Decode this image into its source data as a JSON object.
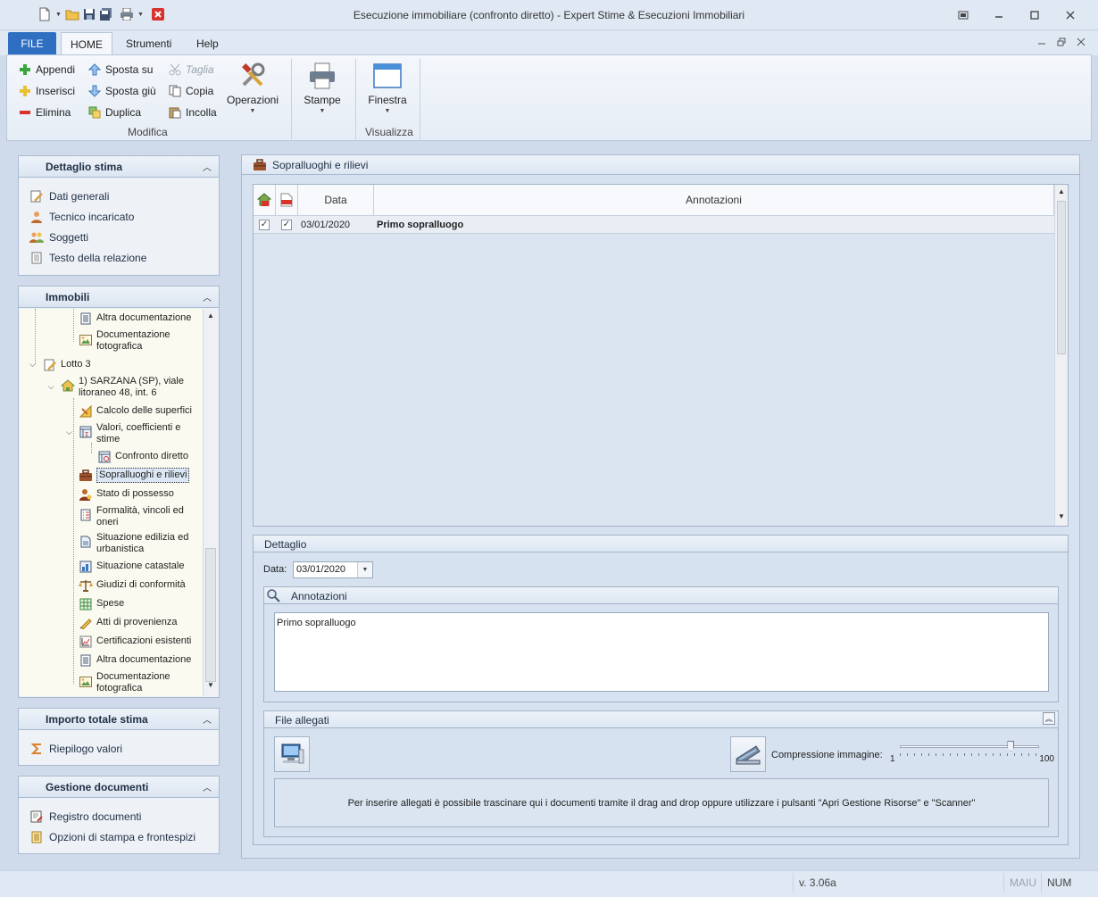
{
  "window": {
    "title": "Esecuzione immobiliare (confronto diretto) - Expert Stime & Esecuzioni Immobiliari"
  },
  "tabs": {
    "file": "FILE",
    "home": "HOME",
    "strumenti": "Strumenti",
    "help": "Help"
  },
  "ribbon": {
    "appendi": "Appendi",
    "inserisci": "Inserisci",
    "elimina": "Elimina",
    "sposta_su": "Sposta su",
    "sposta_giu": "Sposta giù",
    "duplica": "Duplica",
    "taglia": "Taglia",
    "copia": "Copia",
    "incolla": "Incolla",
    "operazioni": "Operazioni",
    "group_modifica": "Modifica",
    "stampe": "Stampe",
    "finestra": "Finestra",
    "group_visualizza": "Visualizza"
  },
  "left": {
    "dettaglio": {
      "title": "Dettaglio stima",
      "items": [
        "Dati generali",
        "Tecnico incaricato",
        "Soggetti",
        "Testo della relazione"
      ]
    },
    "immobili": {
      "title": "Immobili",
      "tree": {
        "altra_doc_1": "Altra documentazione",
        "doc_foto_1a": "Documentazione",
        "doc_foto_1b": "fotografica",
        "lotto": "Lotto 3",
        "imm_a": "1) SARZANA (SP), viale",
        "imm_b": "litoraneo 48, int. 6",
        "calcolo": "Calcolo delle superfici",
        "valori_a": "Valori, coefficienti e",
        "valori_b": "stime",
        "confronto": "Confronto diretto",
        "sopralluoghi": "Sopralluoghi e rilievi",
        "stato": "Stato di possesso",
        "formalita_a": "Formalità, vincoli ed",
        "formalita_b": "oneri",
        "situazione_a": "Situazione edilizia ed",
        "situazione_b": "urbanistica",
        "catastale": "Situazione catastale",
        "giudizi": "Giudizi di conformità",
        "spese": "Spese",
        "atti": "Atti di provenienza",
        "certificazioni": "Certificazioni esistenti",
        "altra_doc_2": "Altra documentazione",
        "doc_foto_2a": "Documentazione",
        "doc_foto_2b": "fotografica"
      }
    },
    "importo": {
      "title": "Importo totale stima",
      "items": [
        "Riepilogo valori"
      ]
    },
    "gestione": {
      "title": "Gestione documenti",
      "items": [
        "Registro documenti",
        "Opzioni di stampa e frontespizi"
      ]
    }
  },
  "main": {
    "title": "Sopralluoghi e rilievi",
    "grid": {
      "col_data": "Data",
      "col_annotazioni": "Annotazioni",
      "rows": [
        {
          "print_home": true,
          "print_pdf": true,
          "data": "03/01/2020",
          "annotazioni": "Primo sopralluogo"
        }
      ]
    },
    "dettaglio": {
      "title": "Dettaglio",
      "data_label": "Data:",
      "data_value": "03/01/2020",
      "annotazioni_title": "Annotazioni",
      "annotazioni_text": "Primo sopralluogo"
    },
    "allegati": {
      "title": "File allegati",
      "compressione_label": "Compressione immagine:",
      "slider_min": "1",
      "slider_max": "100",
      "slider_value": 80,
      "drop_text": "Per inserire allegati è possibile trascinare qui i documenti tramite il drag and drop oppure utilizzare i pulsanti \"Apri Gestione Risorse\" e \"Scanner\""
    }
  },
  "status": {
    "version": "v. 3.06a",
    "maiu": "MAIU",
    "num": "NUM"
  }
}
